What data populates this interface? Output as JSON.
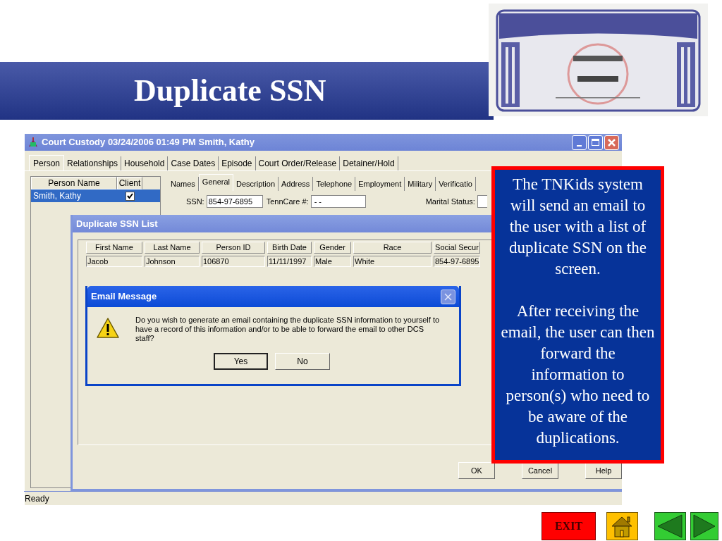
{
  "slide": {
    "title": "Duplicate SSN"
  },
  "window": {
    "title": "Court Custody 03/24/2006 01:49 PM Smith, Kathy",
    "tabs": [
      {
        "label": "Person",
        "selected": true
      },
      {
        "label": "Relationships",
        "selected": false
      },
      {
        "label": "Household",
        "selected": false
      },
      {
        "label": "Case Dates",
        "selected": false
      },
      {
        "label": "Episode",
        "selected": false
      },
      {
        "label": "Court Order/Release",
        "selected": false
      },
      {
        "label": "Detainer/Hold",
        "selected": false
      }
    ],
    "person_list": {
      "columns": [
        "Person Name",
        "Client"
      ],
      "rows": [
        {
          "name": "Smith, Kathy",
          "client": true,
          "selected": true
        }
      ]
    },
    "sub_tabs": [
      {
        "label": "Names",
        "selected": false
      },
      {
        "label": "General",
        "selected": true
      },
      {
        "label": "Description",
        "selected": false
      },
      {
        "label": "Address",
        "selected": false
      },
      {
        "label": "Telephone",
        "selected": false
      },
      {
        "label": "Employment",
        "selected": false
      },
      {
        "label": "Military",
        "selected": false
      },
      {
        "label": "Verificatio",
        "selected": false
      }
    ],
    "fields": [
      {
        "label": "SSN:",
        "value": "854-97-6895"
      },
      {
        "label": "TennCare #:",
        "value": "- -"
      },
      {
        "label": "Marital Status:"
      }
    ],
    "status_bar": "Ready"
  },
  "duplicate_dialog": {
    "title": "Duplicate SSN List",
    "columns": [
      "First Name",
      "Last Name",
      "Person ID",
      "Birth Date",
      "Gender",
      "Race",
      "Social Secur"
    ],
    "rows": [
      [
        "Jacob",
        "Johnson",
        "106870",
        "11/11/1997",
        "Male",
        "White",
        "854-97-6895"
      ]
    ],
    "buttons": [
      "OK",
      "Cancel",
      "Help"
    ]
  },
  "email_dialog": {
    "title": "Email Message",
    "message": "Do you wish to generate an email containing the duplicate SSN information to yourself to have a record of this information and/or to be able to forward the email to other DCS staff?",
    "buttons": [
      {
        "label": "Yes",
        "default": true
      },
      {
        "label": "No",
        "default": false
      }
    ]
  },
  "callout": {
    "paragraphs": [
      "The TNKids system will send an email to the user with a list of duplicate SSN on the screen.",
      "After receiving the email, the user can then forward the information to person(s) who need to be aware of the duplications."
    ]
  },
  "nav": {
    "exit": "EXIT"
  }
}
